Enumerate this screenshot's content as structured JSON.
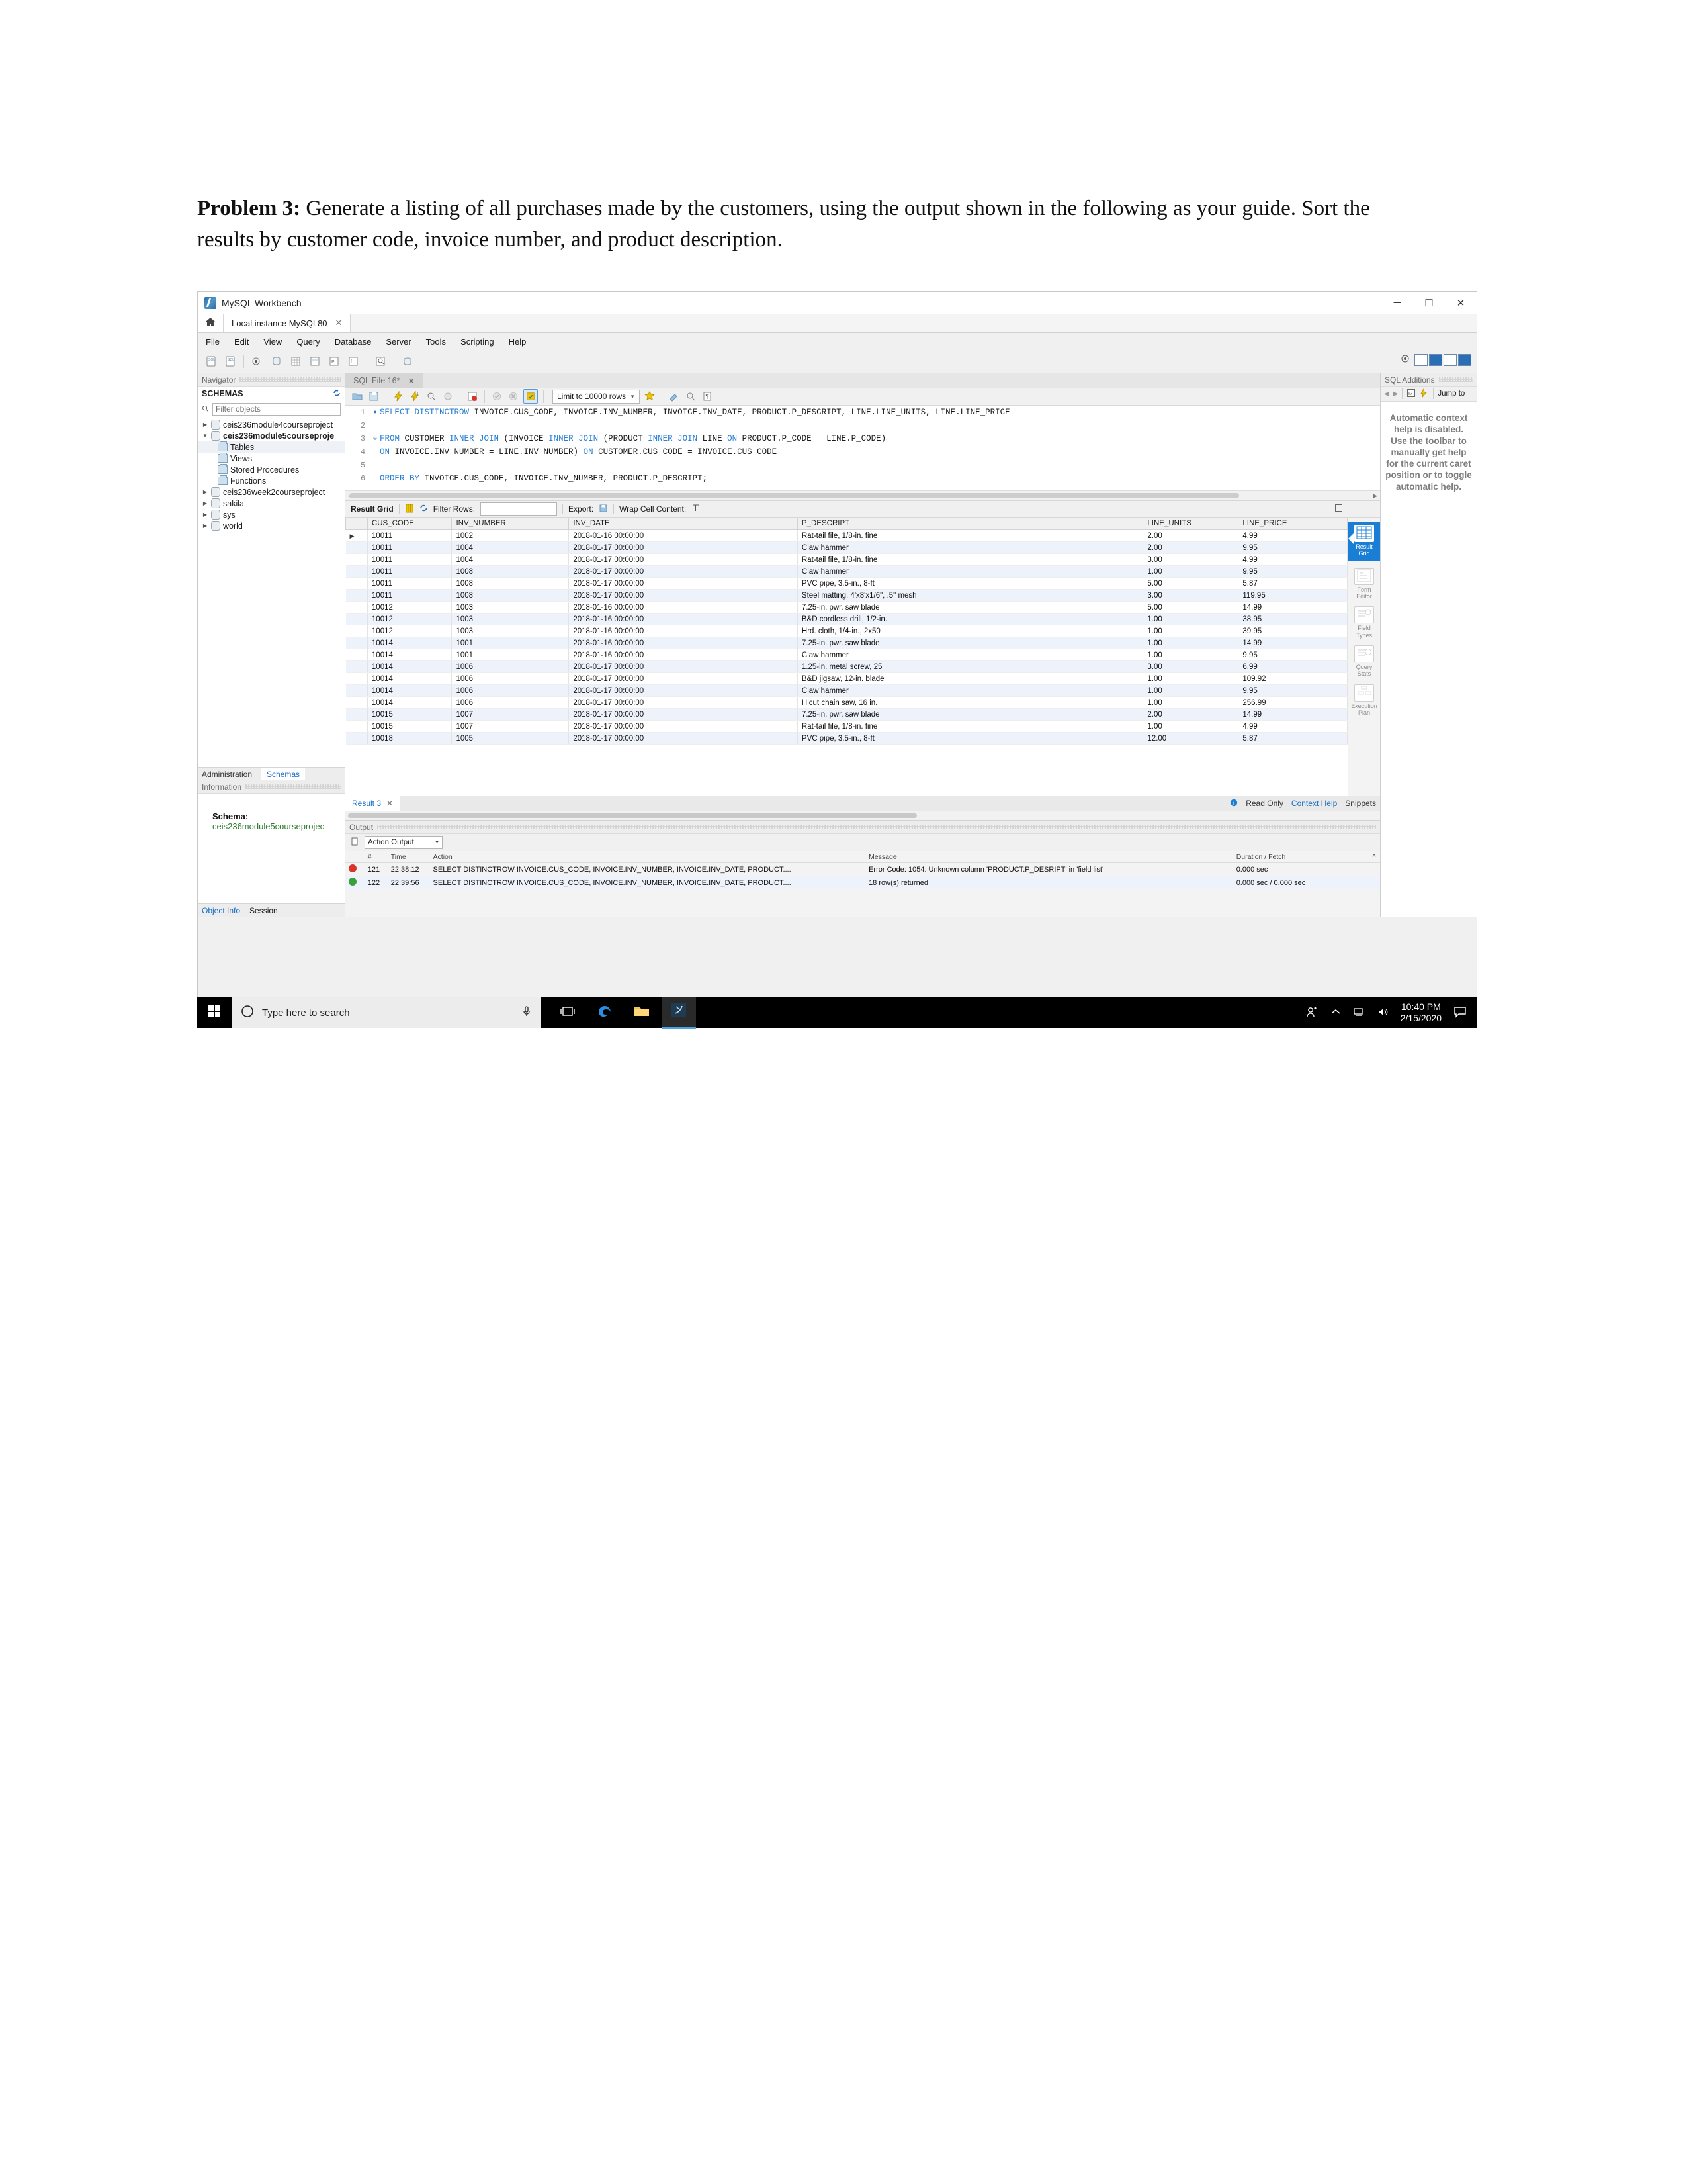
{
  "document": {
    "problem_label": "Problem 3:",
    "problem_text": " Generate a listing of all purchases made by the customers, using the output shown in the following as your guide. Sort the results by customer code, invoice number, and product description."
  },
  "window": {
    "title": "MySQL Workbench",
    "minimize": "─",
    "maximize": "☐",
    "close": "✕"
  },
  "tabs": {
    "home_icon": "home-icon",
    "connection": "Local instance MySQL80",
    "close_glyph": "✕"
  },
  "menu": {
    "items": [
      "File",
      "Edit",
      "View",
      "Query",
      "Database",
      "Server",
      "Tools",
      "Scripting",
      "Help"
    ]
  },
  "navigator": {
    "panel_title": "Navigator",
    "schemas_label": "SCHEMAS",
    "refresh_icon": "refresh-icon",
    "filter_placeholder": "Filter objects",
    "filter_value": "",
    "search_icon": "search-icon",
    "tree": [
      {
        "label": "ceis236module4courseproject",
        "type": "schema",
        "expanded": false,
        "selected": false,
        "bold": false
      },
      {
        "label": "ceis236module5courseproje",
        "type": "schema",
        "expanded": true,
        "selected": false,
        "bold": true
      },
      {
        "label": "Tables",
        "type": "folder",
        "selected": true
      },
      {
        "label": "Views",
        "type": "folder",
        "selected": false
      },
      {
        "label": "Stored Procedures",
        "type": "folder",
        "selected": false
      },
      {
        "label": "Functions",
        "type": "folder",
        "selected": false
      },
      {
        "label": "ceis236week2courseproject",
        "type": "schema",
        "expanded": false,
        "selected": false,
        "bold": false
      },
      {
        "label": "sakila",
        "type": "schema",
        "expanded": false,
        "selected": false,
        "bold": false
      },
      {
        "label": "sys",
        "type": "schema",
        "expanded": false,
        "selected": false,
        "bold": false
      },
      {
        "label": "world",
        "type": "schema",
        "expanded": false,
        "selected": false,
        "bold": false
      }
    ],
    "nav_tabs": [
      "Administration",
      "Schemas"
    ],
    "nav_tab_active": "Schemas",
    "information_title": "Information",
    "info_key": "Schema:",
    "info_value": "ceis236module5courseprojec",
    "bottom_tabs": [
      "Object Info",
      "Session"
    ],
    "bottom_tab_active": "Object Info"
  },
  "editor": {
    "tab_label": "SQL File 16*",
    "tab_close": "✕",
    "limit_label": "Limit to 10000 rows",
    "lines": [
      {
        "n": "1",
        "marker": true,
        "text": "SELECT DISTINCTROW INVOICE.CUS_CODE, INVOICE.INV_NUMBER, INVOICE.INV_DATE, PRODUCT.P_DESCRIPT, LINE.LINE_UNITS, LINE.LINE_PRICE"
      },
      {
        "n": "2",
        "marker": false,
        "text": ""
      },
      {
        "n": "3",
        "marker": false,
        "text": "FROM CUSTOMER INNER JOIN (INVOICE INNER JOIN (PRODUCT INNER JOIN LINE ON PRODUCT.P_CODE = LINE.P_CODE)"
      },
      {
        "n": "4",
        "marker": false,
        "text": "ON INVOICE.INV_NUMBER = LINE.INV_NUMBER) ON CUSTOMER.CUS_CODE = INVOICE.CUS_CODE"
      },
      {
        "n": "5",
        "marker": false,
        "text": ""
      },
      {
        "n": "6",
        "marker": false,
        "text": "ORDER BY INVOICE.CUS_CODE, INVOICE.INV_NUMBER, PRODUCT.P_DESCRIPT;"
      }
    ]
  },
  "result_toolbar": {
    "result_grid_label": "Result Grid",
    "filter_label": "Filter Rows:",
    "filter_value": "",
    "export_label": "Export:",
    "wrap_label": "Wrap Cell Content:"
  },
  "result_grid": {
    "columns": [
      "CUS_CODE",
      "INV_NUMBER",
      "INV_DATE",
      "P_DESCRIPT",
      "LINE_UNITS",
      "LINE_PRICE"
    ],
    "rows": [
      [
        "10011",
        "1002",
        "2018-01-16 00:00:00",
        "Rat-tail file, 1/8-in. fine",
        "2.00",
        "4.99"
      ],
      [
        "10011",
        "1004",
        "2018-01-17 00:00:00",
        "Claw hammer",
        "2.00",
        "9.95"
      ],
      [
        "10011",
        "1004",
        "2018-01-17 00:00:00",
        "Rat-tail file, 1/8-in. fine",
        "3.00",
        "4.99"
      ],
      [
        "10011",
        "1008",
        "2018-01-17 00:00:00",
        "Claw hammer",
        "1.00",
        "9.95"
      ],
      [
        "10011",
        "1008",
        "2018-01-17 00:00:00",
        "PVC pipe, 3.5-in., 8-ft",
        "5.00",
        "5.87"
      ],
      [
        "10011",
        "1008",
        "2018-01-17 00:00:00",
        "Steel matting, 4'x8'x1/6\", .5\" mesh",
        "3.00",
        "119.95"
      ],
      [
        "10012",
        "1003",
        "2018-01-16 00:00:00",
        "7.25-in. pwr. saw blade",
        "5.00",
        "14.99"
      ],
      [
        "10012",
        "1003",
        "2018-01-16 00:00:00",
        "B&D cordless drill, 1/2-in.",
        "1.00",
        "38.95"
      ],
      [
        "10012",
        "1003",
        "2018-01-16 00:00:00",
        "Hrd. cloth, 1/4-in., 2x50",
        "1.00",
        "39.95"
      ],
      [
        "10014",
        "1001",
        "2018-01-16 00:00:00",
        "7.25-in. pwr. saw blade",
        "1.00",
        "14.99"
      ],
      [
        "10014",
        "1001",
        "2018-01-16 00:00:00",
        "Claw hammer",
        "1.00",
        "9.95"
      ],
      [
        "10014",
        "1006",
        "2018-01-17 00:00:00",
        "1.25-in. metal screw, 25",
        "3.00",
        "6.99"
      ],
      [
        "10014",
        "1006",
        "2018-01-17 00:00:00",
        "B&D jigsaw, 12-in. blade",
        "1.00",
        "109.92"
      ],
      [
        "10014",
        "1006",
        "2018-01-17 00:00:00",
        "Claw hammer",
        "1.00",
        "9.95"
      ],
      [
        "10014",
        "1006",
        "2018-01-17 00:00:00",
        "Hicut chain saw, 16 in.",
        "1.00",
        "256.99"
      ],
      [
        "10015",
        "1007",
        "2018-01-17 00:00:00",
        "7.25-in. pwr. saw blade",
        "2.00",
        "14.99"
      ],
      [
        "10015",
        "1007",
        "2018-01-17 00:00:00",
        "Rat-tail file, 1/8-in. fine",
        "1.00",
        "4.99"
      ],
      [
        "10018",
        "1005",
        "2018-01-17 00:00:00",
        "PVC pipe, 3.5-in., 8-ft",
        "12.00",
        "5.87"
      ]
    ]
  },
  "grid_side_tabs": [
    {
      "label": "Result\nGrid",
      "icon": "grid-icon",
      "active": true
    },
    {
      "label": "Form\nEditor",
      "icon": "form-icon",
      "active": false
    },
    {
      "label": "Field\nTypes",
      "icon": "field-types-icon",
      "active": false
    },
    {
      "label": "Query\nStats",
      "icon": "query-stats-icon",
      "active": false
    },
    {
      "label": "Execution\nPlan",
      "icon": "execution-plan-icon",
      "active": false
    }
  ],
  "result_tabs": {
    "active": "Result 3",
    "close": "✕",
    "read_only": "Read Only",
    "context_help": "Context Help",
    "snippets": "Snippets",
    "info_icon": "info-icon"
  },
  "output": {
    "panel_title": "Output",
    "selector": "Action Output",
    "columns": [
      "#",
      "Time",
      "Action",
      "Message",
      "Duration / Fetch"
    ],
    "rows": [
      {
        "status": "error",
        "num": "121",
        "time": "22:38:12",
        "action": "SELECT DISTINCTROW INVOICE.CUS_CODE, INVOICE.INV_NUMBER, INVOICE.INV_DATE, PRODUCT....",
        "message": "Error Code: 1054. Unknown column 'PRODUCT.P_DESRIPT' in 'field list'",
        "duration": "0.000 sec"
      },
      {
        "status": "ok",
        "num": "122",
        "time": "22:39:56",
        "action": "SELECT DISTINCTROW INVOICE.CUS_CODE, INVOICE.INV_NUMBER, INVOICE.INV_DATE, PRODUCT....",
        "message": "18 row(s) returned",
        "duration": "0.000 sec / 0.000 sec"
      }
    ]
  },
  "sql_additions": {
    "panel_title": "SQL Additions",
    "back_icon": "back-arrow-icon",
    "forward_icon": "forward-arrow-icon",
    "jump_to": "Jump to",
    "help_text": "Automatic context help is disabled. Use the toolbar to manually get help for the current caret position or to toggle automatic help."
  },
  "taskbar": {
    "start_icon": "windows-start-icon",
    "search_placeholder": "Type here to search",
    "cortana_icon": "cortana-circle-icon",
    "mic_icon": "microphone-icon",
    "apps": [
      {
        "name": "task-view-icon",
        "active": false
      },
      {
        "name": "edge-icon",
        "active": false
      },
      {
        "name": "file-explorer-icon",
        "active": false
      },
      {
        "name": "mysql-workbench-icon",
        "active": true
      }
    ],
    "tray": {
      "people_icon": "people-icon",
      "chevron_icon": "show-hidden-icons-icon",
      "network_icon": "network-icon",
      "volume_icon": "volume-icon",
      "time": "10:40 PM",
      "date": "2/15/2020",
      "action_center_icon": "action-center-icon"
    }
  },
  "colors": {
    "accent": "#1a7fd4",
    "error": "#d8342a",
    "success": "#3aa03a",
    "link": "#1a6fc4",
    "schema_value": "#2e7d32"
  }
}
